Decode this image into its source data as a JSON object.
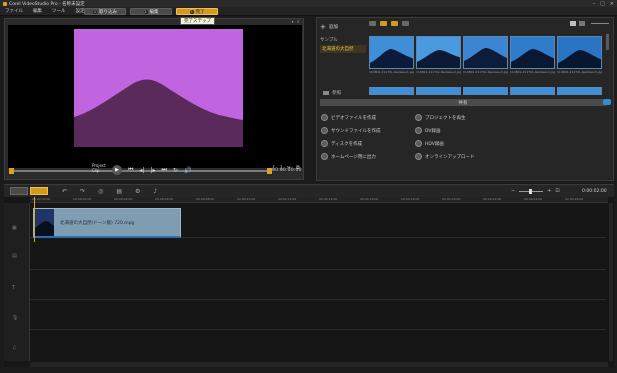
{
  "window": {
    "title": "Corel VideoStudio Pro - 名称未設定",
    "controls": [
      "–",
      "□",
      "×"
    ]
  },
  "menu": {
    "items": [
      "ファイル",
      "編集",
      "ツール",
      "設定"
    ]
  },
  "steps": [
    {
      "num": "1",
      "label": "取り込み"
    },
    {
      "num": "2",
      "label": "編集"
    },
    {
      "num": "3",
      "label": "完了"
    }
  ],
  "tooltip": "完了ステップ",
  "player": {
    "mode_label_1": "Project",
    "mode_label_2": "Clip",
    "timecode": "00:00:00:00",
    "transport": [
      "⏮",
      "◂|",
      "|▸",
      "⏭",
      "↻",
      "🔊"
    ],
    "trim": [
      "[",
      "]",
      "✂",
      "⧉"
    ],
    "colors": {
      "sky": "#c064e0",
      "hill": "#5a2a5a"
    }
  },
  "library": {
    "add_label": "追加",
    "category": "サンプル",
    "selected_folder": "北海道の大自然",
    "browse_label": "参照",
    "thumb_captions": [
      "110801-21170L-Ikezawa-1.jpg",
      "110801-21170L-Ikezawa-2.jpg",
      "110801-21170L-Ikezawa-3.jpg",
      "110801-21170L-Ikezawa-4.jpg",
      "110801-21170L-Ikezawa-5.jpg"
    ],
    "share_label": "共有",
    "share_items": [
      "ビデオファイルを作成",
      "プロジェクトを再生",
      "サウンドファイルを作成",
      "DV録画",
      "ディスクを作成",
      "HDV録画",
      "ホームページ用に出力",
      "オンラインアップロード"
    ]
  },
  "timeline": {
    "tools": [
      "↶",
      "↷",
      "◎",
      "▤",
      "⚙",
      "♪"
    ],
    "time": "0:00:02:00",
    "ruler": [
      "00:00:00:00",
      "00:00:02:00",
      "00:00:04:00",
      "00:00:06:00",
      "00:00:08:00",
      "00:00:10:00",
      "00:00:12:00",
      "00:00:14:00",
      "00:00:16:00",
      "00:00:18:00",
      "00:00:20:00",
      "00:00:22:00",
      "00:00:24:00",
      "00:00:26:00"
    ],
    "clip_label": "北海道の大自然(ドーン版) 720.mpg",
    "zoom_minus": "−",
    "zoom_plus": "+"
  }
}
